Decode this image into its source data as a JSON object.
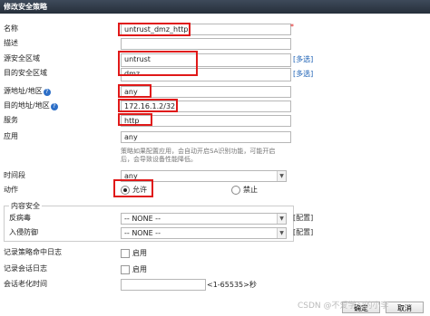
{
  "dialog": {
    "title": "修改安全策略"
  },
  "form": {
    "name": {
      "label": "名称",
      "value": "untrust_dmz_http",
      "required_mark": "*"
    },
    "description": {
      "label": "描述",
      "value": ""
    },
    "src_zone": {
      "label": "源安全区域",
      "value": "untrust",
      "link": "[多选]"
    },
    "dst_zone": {
      "label": "目的安全区域",
      "value": "dmz",
      "link": "[多选]"
    },
    "src_addr": {
      "label": "源地址/地区",
      "value": "any"
    },
    "dst_addr": {
      "label": "目的地址/地区",
      "value": "172.16.1.2/32"
    },
    "service": {
      "label": "服务",
      "value": "http"
    },
    "application": {
      "label": "应用",
      "value": "any"
    },
    "app_hint_line1": "策略如果配置应用，会自动开启SA识别功能，可能开启",
    "app_hint_line2": "后，会导致设备性能降低。",
    "time_range": {
      "label": "时间段",
      "value": "any"
    },
    "action": {
      "label": "动作",
      "allow": "允许",
      "deny": "禁止",
      "selected": "allow"
    },
    "content_security": {
      "legend": "内容安全",
      "antivirus": {
        "label": "反病毒",
        "value": "-- NONE --",
        "link": "[配置]"
      },
      "ips": {
        "label": "入侵防御",
        "value": "-- NONE --",
        "link": "[配置]"
      }
    },
    "log_policy": {
      "label": "记录策略命中日志",
      "option": "启用"
    },
    "log_session": {
      "label": "记录会话日志",
      "option": "启用"
    },
    "session_timeout": {
      "label": "会话老化时间",
      "value": "",
      "hint": "<1-65535>秒"
    }
  },
  "buttons": {
    "ok": "确定",
    "cancel": "取消"
  },
  "watermark": "CSDN @不爱学习的小李"
}
